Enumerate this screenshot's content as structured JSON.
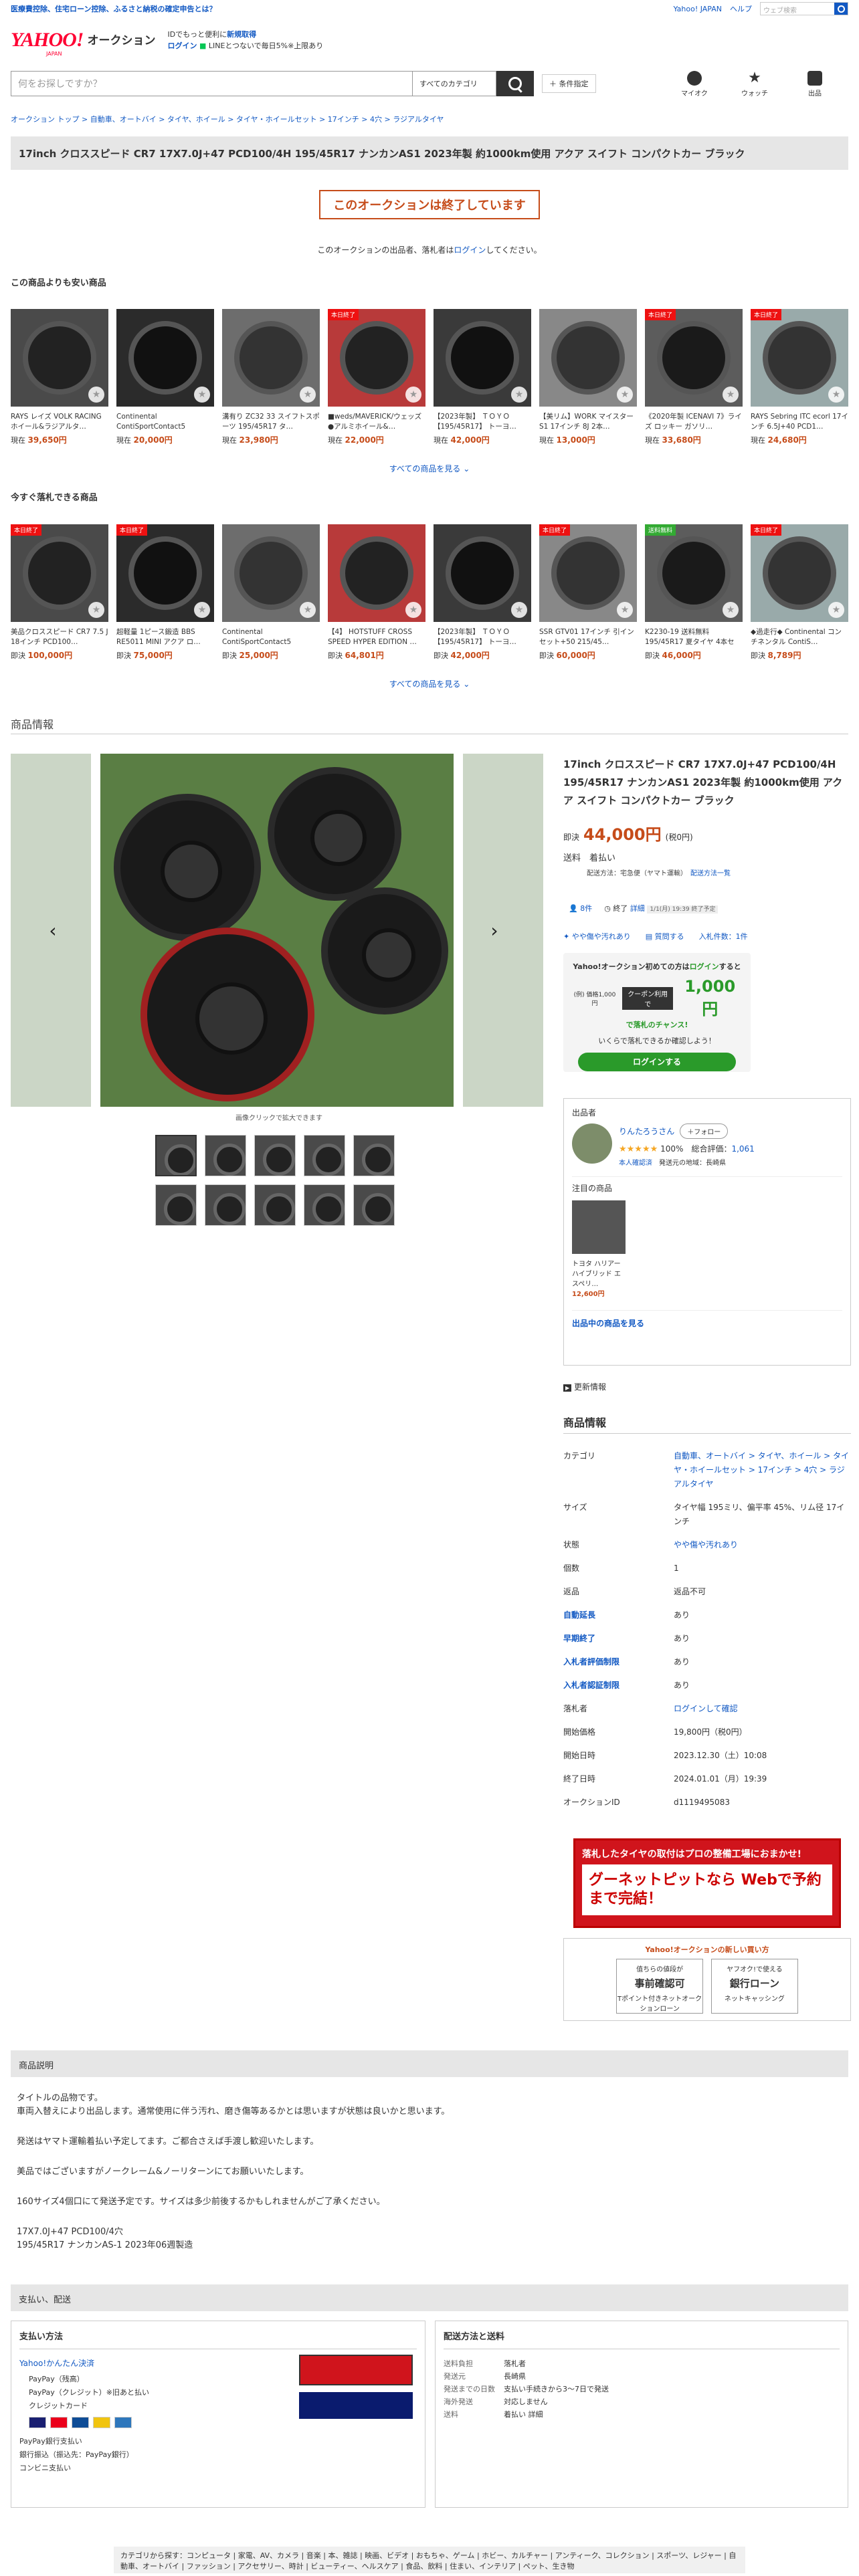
{
  "topbar": {
    "promo": "医療費控除、住宅ローン控除、ふるさと納税の確定申告とは？",
    "links": [
      "Yahoo! JAPAN",
      "ヘルプ"
    ],
    "search_placeholder": "ウェブ検索"
  },
  "header": {
    "logo": "YAHOO!",
    "logo_sub": "JAPAN",
    "service": "オークション",
    "promo1": "IDでもっと便利に",
    "promo1_link": "新規取得",
    "promo2_link": "ログイン",
    "promo2": "LINEとつないで毎日5%※上限あり"
  },
  "search": {
    "placeholder": "何をお探しですか？",
    "category": "すべてのカテゴリ",
    "condition": "＋ 条件指定"
  },
  "navicons": [
    {
      "label": "マイオク"
    },
    {
      "label": "ウォッチ"
    },
    {
      "label": "出品"
    }
  ],
  "breadcrumb": "オークション トップ > 自動車、オートバイ > タイヤ、ホイール > タイヤ・ホイールセット > 17インチ > 4穴 > ラジアルタイヤ",
  "title": "17inch クロススピード CR7 17X7.0J+47 PCD100/4H 195/45R17 ナンカンAS1 2023年製 約1000km使用 アクア スイフト コンパクトカー ブラック",
  "ended": {
    "label": "このオークションは終了しています",
    "note_pre": "このオークションの出品者、落札者は",
    "note_link": "ログイン",
    "note_post": "してください。"
  },
  "cheaper": {
    "title": "この商品よりも安い商品",
    "more": "すべての商品を見る",
    "items": [
      {
        "name": "RAYS レイズ VOLK RACING ホイール&ラジアルタ…",
        "kind": "現在",
        "price": "39,650円",
        "badge": ""
      },
      {
        "name": "Continental ContiSportContact5 195/45R17 202…",
        "kind": "現在",
        "price": "20,000円",
        "badge": ""
      },
      {
        "name": "溝有り ZC32 33 スイフトスポーツ 195/45R17 タ…",
        "kind": "現在",
        "price": "23,980円",
        "badge": ""
      },
      {
        "name": "■weds/MAVERICK/ウェッズ●アルミホイール&…",
        "kind": "現在",
        "price": "22,000円",
        "badge": "本日終了"
      },
      {
        "name": "【2023年製】 ＴＯＹＯ【195/45R17】 トーヨ…",
        "kind": "現在",
        "price": "42,000円",
        "badge": ""
      },
      {
        "name": "【美リム】WORK マイスター S1 17インチ 8J 2本…",
        "kind": "現在",
        "price": "13,000円",
        "badge": ""
      },
      {
        "name": "《2020年製 ICENAVI 7》ライズ ロッキー ガソリ…",
        "kind": "現在",
        "price": "33,680円",
        "badge": "本日終了"
      },
      {
        "name": "RAYS Sebring ITC ecorl 17インチ 6.5J+40 PCD1…",
        "kind": "現在",
        "price": "24,680円",
        "badge": "本日終了"
      }
    ]
  },
  "soon": {
    "title": "今すぐ落札できる商品",
    "more": "すべての商品を見る",
    "items": [
      {
        "name": "美品クロススピード CR7 7.5 J 18インチ PCD100…",
        "kind": "即決",
        "price": "100,000円",
        "badge": "本日終了"
      },
      {
        "name": "超軽量 1ピース鍛造 BBS RE5011 MINI アクア ロ…",
        "kind": "即決",
        "price": "75,000円",
        "badge": "本日終了"
      },
      {
        "name": "Continental ContiSportContact5 195/45R17 202…",
        "kind": "即決",
        "price": "25,000円",
        "badge": ""
      },
      {
        "name": "【4】 HOTSTUFF CROSS SPEED HYPER EDITION …",
        "kind": "即決",
        "price": "64,801円",
        "badge": ""
      },
      {
        "name": "【2023年製】 ＴＯＹＯ【195/45R17】 トーヨ…",
        "kind": "即決",
        "price": "42,000円",
        "badge": ""
      },
      {
        "name": "SSR GTV01 17インチ 引インセット+50 215/45…",
        "kind": "即決",
        "price": "60,000円",
        "badge": "本日終了"
      },
      {
        "name": "K2230-19 送料無料 195/45R17 夏タイヤ 4本セッ…",
        "kind": "即決",
        "price": "46,000円",
        "badge": "送料無料"
      },
      {
        "name": "◆過走行◆ Continental コンチネンタル ContiS…",
        "kind": "即決",
        "price": "8,789円",
        "badge": "本日終了"
      }
    ]
  },
  "info_heading": "商品情報",
  "gallery": {
    "caption": "画像クリックで拡大できます"
  },
  "price": {
    "kind": "即決",
    "value": "44,000円",
    "tax": "(税0円)"
  },
  "shipping": {
    "label": "送料",
    "value": "着払い",
    "method": "配送方法：宅急便（ヤマト運輸）",
    "method_link": "配送方法一覧"
  },
  "stats": {
    "watch": "8件",
    "end": "終了",
    "detail": "詳細",
    "date_note": "1/1(月) 19:39 終了予定"
  },
  "condition_stats": {
    "condition": "やや傷や汚れあり",
    "history": "質問する",
    "bids": "入札件数：1件"
  },
  "loginbox": {
    "l1_pre": "Yahoo!オークション初めての方は",
    "l1_link": "ログイン",
    "l1_post": "すると",
    "l2": "(例) 価格1,000円",
    "coupon": "クーポン利用で",
    "amount": "1,000円",
    "l3": "で落札のチャンス!",
    "l4": "いくらで落札できるか確認しよう！",
    "btn": "ログインする"
  },
  "seller": {
    "label": "出品者",
    "name": "りんたろうさん",
    "follow": "＋フォロー",
    "rating": "100%",
    "total_label": "総合評価：",
    "total": "1,061",
    "verified": "本人確認済",
    "origin": "発送元の地域：長崎県",
    "attention": "注目の商品",
    "att_name": "トヨタ ハリアー ハイブリッド エスペリ…",
    "att_price": "12,600円",
    "link": "出品中の商品を見る"
  },
  "update": "更新情報",
  "spec": {
    "heading": "商品情報",
    "rows": [
      {
        "k": "カテゴリ",
        "v": "自動車、オートバイ > タイヤ、ホイール > タイヤ・ホイールセット > 17インチ > 4穴 > ラジアルタイヤ",
        "b": false,
        "link": true
      },
      {
        "k": "サイズ",
        "v": "タイヤ幅 195ミリ、偏平率 45%、リム径 17インチ",
        "b": false,
        "link": false
      },
      {
        "k": "状態",
        "v": "やや傷や汚れあり",
        "b": false,
        "link": true
      },
      {
        "k": "個数",
        "v": "1",
        "b": false,
        "link": false
      },
      {
        "k": "返品",
        "v": "返品不可",
        "b": false,
        "link": false
      },
      {
        "k": "自動延長",
        "v": "あり",
        "b": true,
        "link": false
      },
      {
        "k": "早期終了",
        "v": "あり",
        "b": true,
        "link": false
      },
      {
        "k": "入札者評価制限",
        "v": "あり",
        "b": true,
        "link": false
      },
      {
        "k": "入札者認証制限",
        "v": "あり",
        "b": true,
        "link": false
      },
      {
        "k": "落札者",
        "v": "ログインして確認",
        "b": false,
        "link": true
      },
      {
        "k": "開始価格",
        "v": "19,800円（税0円）",
        "b": false,
        "link": false
      },
      {
        "k": "開始日時",
        "v": "2023.12.30（土）10:08",
        "b": false,
        "link": false
      },
      {
        "k": "終了日時",
        "v": "2024.01.01（月）19:39",
        "b": false,
        "link": false
      },
      {
        "k": "オークションID",
        "v": "d1119495083",
        "b": false,
        "link": false
      }
    ]
  },
  "ad1": {
    "top": "落札したタイヤの取付はプロの整備工場におまかせ!",
    "main": "グーネットピットなら Webで予約まで完結！"
  },
  "ad2": {
    "title": "Yahoo!オークションの新しい買い方",
    "b1_top": "值ちらの値段が",
    "b1": "事前確認可",
    "b1_sub": "Tポイント付きネットオークションローン",
    "b2_top": "ヤフオク!で使える",
    "b2": "銀行ローン",
    "b2_sub": "ネットキャッシング"
  },
  "desc": {
    "heading": "商品説明",
    "paras": [
      "タイトルの品物です。\n車両入替えにより出品します。通常使用に伴う汚れ、磨き傷等あるかとは思いますが状態は良いかと思います。",
      "発送はヤマト運輸着払い予定してます。ご都合さえば手渡し歓迎いたします。",
      "美品ではございますがノークレーム&ノーリターンにてお願いいたします。",
      "160サイズ4個口にて発送予定です。サイズは多少前後するかもしれませんがご了承ください。",
      "17X7.0J+47 PCD100/4穴\n195/45R17 ナンカンAS-1 2023年06週製造"
    ]
  },
  "pay": {
    "heading": "支払い、配送",
    "left_title": "支払い方法",
    "yahoo": "Yahoo!かんたん決済",
    "methods": [
      "PayPay（残高）",
      "PayPay（クレジット）※旧あと払い",
      "クレジットカード"
    ],
    "others": [
      "PayPay銀行支払い",
      "銀行振込（振込先：PayPay銀行）",
      "コンビニ支払い"
    ],
    "right_title": "配送方法と送料",
    "ship_rows": [
      [
        "送料負担",
        "落札者"
      ],
      [
        "発送元",
        "長崎県"
      ],
      [
        "発送までの日数",
        "支払い手続きから3〜7日で発送"
      ],
      [
        "海外発送",
        "対応しません"
      ],
      [
        "送料",
        "着払い 詳細"
      ]
    ]
  },
  "footer": "カテゴリから探す：コンピュータ | 家電、AV、カメラ | 音楽 | 本、雑誌 | 映画、ビデオ | おもちゃ、ゲーム | ホビー、カルチャー | アンティーク、コレクション | スポーツ、レジャー | 自動車、オートバイ | ファッション | アクセサリー、時計 | ビューティー、ヘルスケア | 食品、飲料 | 住まい、インテリア | ペット、生き物",
  "colors": {
    "accent": "#c64c1a",
    "link": "#1259c3",
    "brand": "#ff0033",
    "green": "#2a9a2a"
  }
}
